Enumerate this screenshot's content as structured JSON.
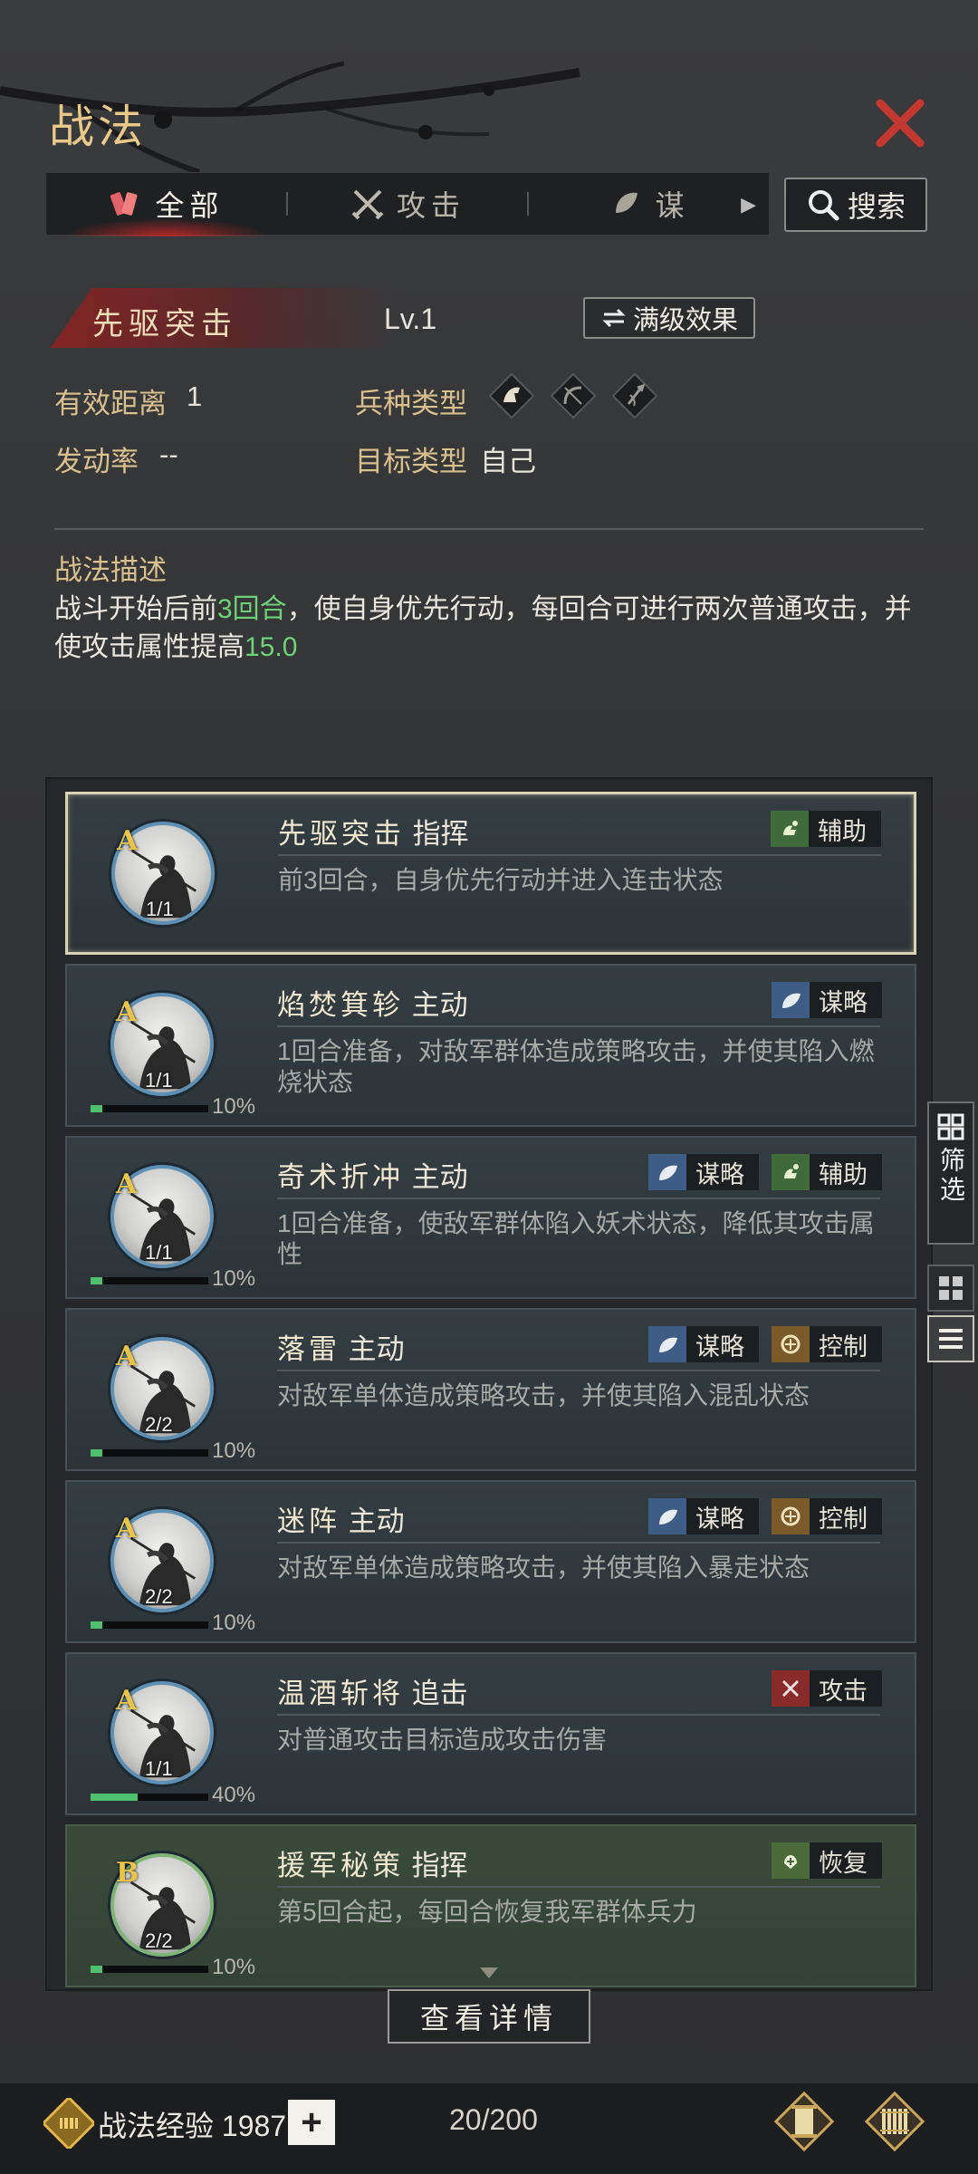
{
  "header": {
    "title": "战法",
    "close_icon": "close-icon"
  },
  "tabs": [
    {
      "label": "全部",
      "icon": "all-icon",
      "active": true
    },
    {
      "label": "攻击",
      "icon": "swords-icon"
    },
    {
      "label": "谋",
      "icon": "strategy-icon"
    }
  ],
  "search": {
    "label": "搜索"
  },
  "skill": {
    "name": "先驱突击",
    "level": "Lv.1",
    "max_button": "满级效果",
    "range_label": "有效距离",
    "range_value": "1",
    "unit_type_label": "兵种类型",
    "rate_label": "发动率",
    "rate_value": "--",
    "target_label": "目标类型",
    "target_value": "自己",
    "desc_title": "战法描述",
    "desc_part1": "战斗开始后前",
    "desc_hl1": "3回合",
    "desc_part2": "，使自身优先行动，每回合可进行两次普通攻击，并使攻击属性提高",
    "desc_hl2": "15.0"
  },
  "list": [
    {
      "grade": "A",
      "stack": "1/1",
      "name": "先驱突击",
      "type": "指挥",
      "desc": "前3回合，自身优先行动并进入连击状态",
      "tags": [
        "辅助"
      ],
      "progress": null,
      "pct": ""
    },
    {
      "grade": "A",
      "stack": "1/1",
      "name": "焰焚箕轸",
      "type": "主动",
      "desc": "1回合准备，对敌军群体造成策略攻击，并使其陷入燃烧状态",
      "tags": [
        "谋略"
      ],
      "progress": 0.1,
      "pct": "10%"
    },
    {
      "grade": "A",
      "stack": "1/1",
      "name": "奇术折冲",
      "type": "主动",
      "desc": "1回合准备，使敌军群体陷入妖术状态，降低其攻击属性",
      "tags": [
        "谋略",
        "辅助"
      ],
      "progress": 0.1,
      "pct": "10%"
    },
    {
      "grade": "A",
      "stack": "2/2",
      "name": "落雷",
      "type": "主动",
      "desc": "对敌军单体造成策略攻击，并使其陷入混乱状态",
      "tags": [
        "谋略",
        "控制"
      ],
      "progress": 0.1,
      "pct": "10%"
    },
    {
      "grade": "A",
      "stack": "2/2",
      "name": "迷阵",
      "type": "主动",
      "desc": "对敌军单体造成策略攻击，并使其陷入暴走状态",
      "tags": [
        "谋略",
        "控制"
      ],
      "progress": 0.1,
      "pct": "10%"
    },
    {
      "grade": "A",
      "stack": "1/1",
      "name": "温酒斩将",
      "type": "追击",
      "desc": "对普通攻击目标造成攻击伤害",
      "tags": [
        "攻击"
      ],
      "progress": 0.4,
      "pct": "40%"
    },
    {
      "grade": "B",
      "stack": "2/2",
      "name": "援军秘策",
      "type": "指挥",
      "desc": "第5回合起，每回合恢复我军群体兵力",
      "tags": [
        "恢复"
      ],
      "progress": 0.1,
      "pct": "10%"
    }
  ],
  "side": {
    "filter_label": "筛选"
  },
  "detail_button": "查看详情",
  "footer": {
    "exp_label": "战法经验",
    "exp_value": "1987",
    "count": "20/200"
  },
  "colors": {
    "accent_gold": "#d9c08f",
    "highlight_green": "#6fd07a",
    "close_red": "#c0392b"
  }
}
